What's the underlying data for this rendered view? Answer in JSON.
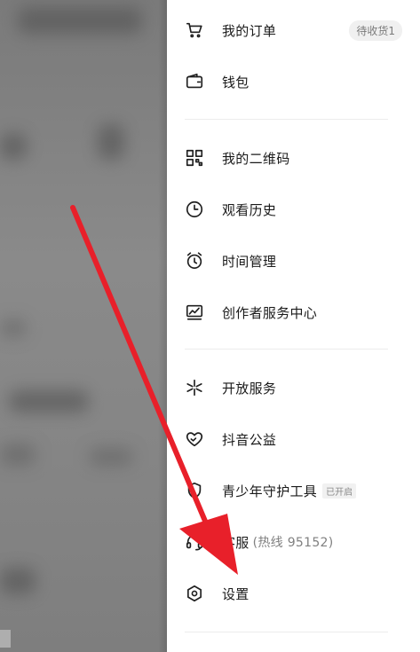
{
  "menu": {
    "orders": {
      "label": "我的订单",
      "badge": "待收货1",
      "icon": "cart-icon"
    },
    "wallet": {
      "label": "钱包",
      "icon": "wallet-icon"
    },
    "qrcode": {
      "label": "我的二维码",
      "icon": "qrcode-icon"
    },
    "history": {
      "label": "观看历史",
      "icon": "clock-icon"
    },
    "time": {
      "label": "时间管理",
      "icon": "alarm-icon"
    },
    "creator": {
      "label": "创作者服务中心",
      "icon": "chart-monitor-icon"
    },
    "open_service": {
      "label": "开放服务",
      "icon": "sparkle-icon"
    },
    "charity": {
      "label": "抖音公益",
      "icon": "heart-icon"
    },
    "youth": {
      "label": "青少年守护工具",
      "tag": "已开启",
      "icon": "shield-icon"
    },
    "support": {
      "label": "客服",
      "sub": "(热线 95152)",
      "icon": "headset-icon"
    },
    "settings": {
      "label": "设置",
      "icon": "hexagon-settings-icon"
    }
  },
  "colors": {
    "annotation_arrow": "#e8202a",
    "text": "#1a1a1a",
    "muted": "#808080"
  }
}
